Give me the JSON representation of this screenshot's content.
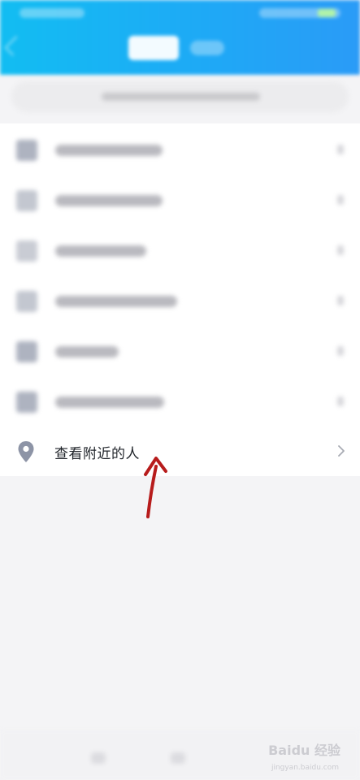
{
  "menu": {
    "nearby_label": "查看附近的人"
  },
  "watermark": {
    "text": "Baidu 经验",
    "url": "jingyan.baidu.com"
  },
  "colors": {
    "header_start": "#12bdf2",
    "header_end": "#2a9bf7",
    "pin_icon": "#8d94a6",
    "arrow": "#b71c1c"
  }
}
